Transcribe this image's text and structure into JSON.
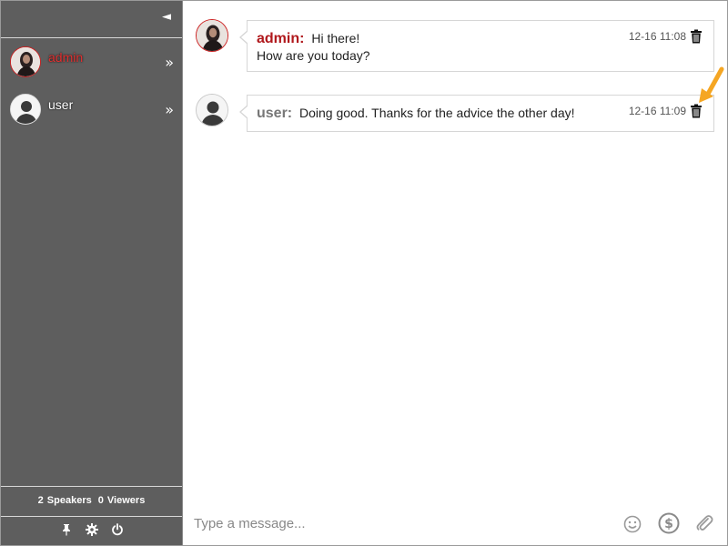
{
  "sidebar": {
    "collapse_glyph": "◄",
    "users": [
      {
        "name": "admin",
        "chevron": "»"
      },
      {
        "name": "user",
        "chevron": "»"
      }
    ],
    "counts": {
      "speakers_num": "2",
      "speakers_label": "Speakers",
      "viewers_num": "0",
      "viewers_label": "Viewers"
    },
    "tools": [
      "pin-icon",
      "gear-icon",
      "power-icon"
    ]
  },
  "messages": [
    {
      "author": "admin:",
      "lines": [
        "Hi there!",
        "How are you today?"
      ],
      "time": "12-16 11:08"
    },
    {
      "author": "user:",
      "lines": [
        "Doing good. Thanks for the advice the other day!"
      ],
      "time": "12-16 11:09"
    }
  ],
  "composer": {
    "placeholder": "Type a message...",
    "icons": [
      "emoji-icon",
      "dollar-icon",
      "paperclip-icon"
    ]
  },
  "colors": {
    "sidebar_bg": "#5e5e5e",
    "admin_name": "#b0181c",
    "user_name": "#777777",
    "arrow": "#f5a623"
  }
}
